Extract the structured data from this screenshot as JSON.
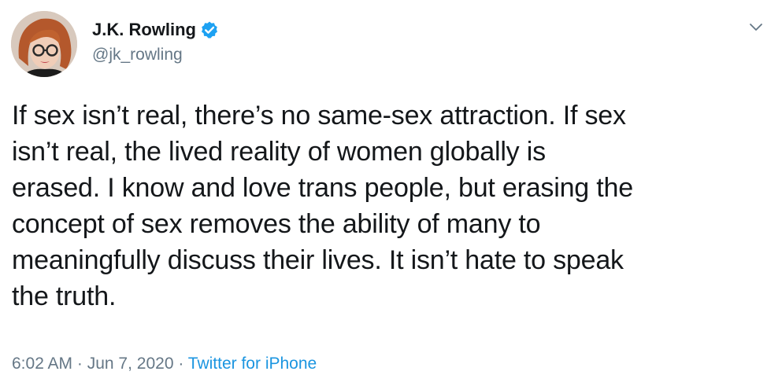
{
  "author": {
    "display_name": "J.K. Rowling",
    "handle": "@jk_rowling",
    "verified": true
  },
  "tweet": {
    "lines": [
      "If sex isn’t real, there’s no same-sex attraction. If sex",
      "isn’t real, the lived reality of women globally is",
      "erased. I know and love trans people, but erasing the",
      "concept of sex removes the ability of many to",
      "meaningfully discuss their lives. It isn’t hate to speak",
      "the truth."
    ]
  },
  "meta": {
    "time": "6:02 AM",
    "separator1": " · ",
    "date": "Jun 7, 2020",
    "separator2": " · ",
    "source": "Twitter for iPhone"
  },
  "icons": {
    "verified": "verified-badge-icon",
    "menu": "chevron-down-icon"
  },
  "colors": {
    "text": "#14171a",
    "secondary": "#657786",
    "link": "#1b95e0",
    "verified": "#1da1f2"
  }
}
